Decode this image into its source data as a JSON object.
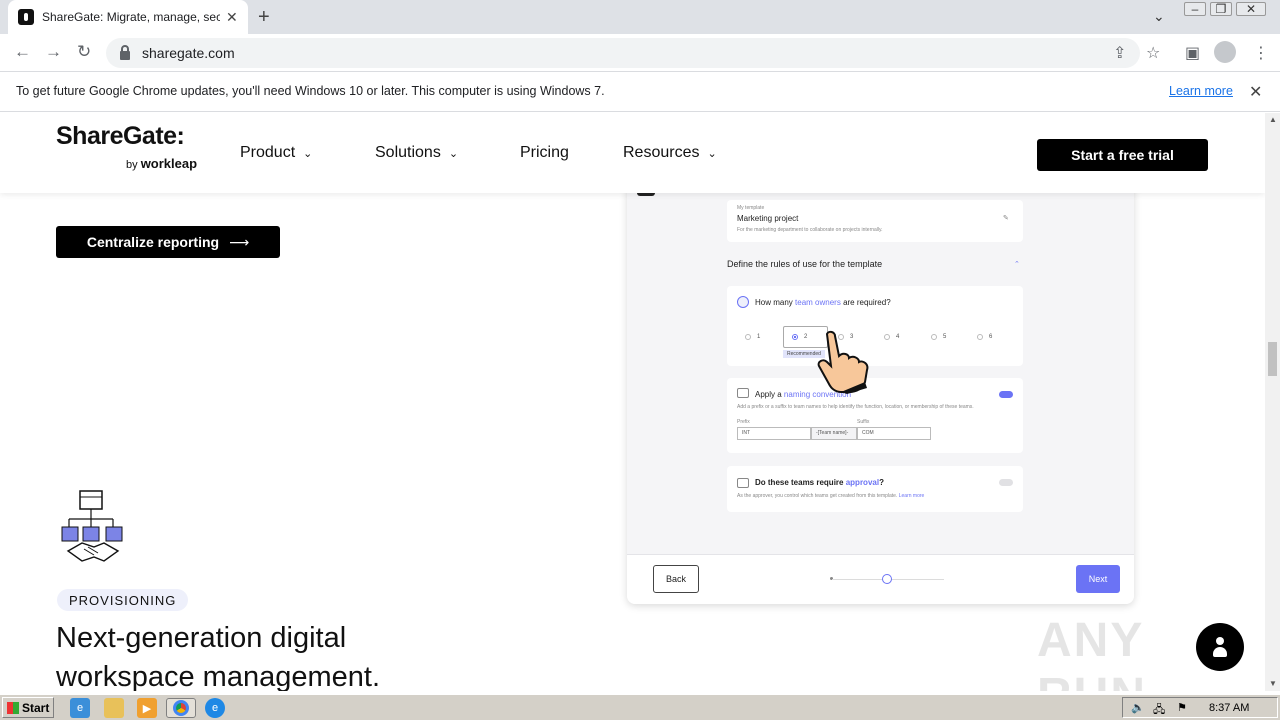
{
  "browser": {
    "tab_title": "ShareGate: Migrate, manage, secure",
    "url": "sharegate.com",
    "infobar_message": "To get future Google Chrome updates, you'll need Windows 10 or later. This computer is using Windows 7.",
    "infobar_link": "Learn more"
  },
  "site": {
    "logo": "ShareGate:",
    "logo_by": "by",
    "logo_parent": "workleap",
    "nav": [
      "Product",
      "Solutions",
      "Pricing",
      "Resources"
    ],
    "cta_trial": "Start a free trial"
  },
  "content": {
    "centralize_button": "Centralize reporting",
    "badge": "PROVISIONING",
    "headline": "Next-generation digital workspace management."
  },
  "mock": {
    "template_small": "My template",
    "template_name": "Marketing project",
    "template_desc": "For the marketing department to collaborate on projects internally.",
    "rules_title": "Define the rules of use for the template",
    "owners_q_pre": "How many",
    "owners_q_hl": "team owners",
    "owners_q_post": "are required?",
    "owner_options": [
      "1",
      "2",
      "3",
      "4",
      "5",
      "6"
    ],
    "owner_selected": "2",
    "recommended": "Recommended",
    "naming_pre": "Apply a",
    "naming_hl": "naming convention",
    "naming_desc": "Add a prefix or a suffix to team names to help identify the function, location, or membership of these teams.",
    "prefix_label": "Prefix",
    "suffix_label": "Suffix",
    "prefix_value": "INT",
    "team_name": "-[Team name]-",
    "suffix_value": "COM",
    "approval_pre": "Do these teams require",
    "approval_hl": "approval",
    "approval_post": "?",
    "approval_desc": "As the approver, you control which teams get created from this template.",
    "approval_link": "Learn more",
    "back": "Back",
    "next": "Next",
    "accent": "#6b73f5"
  },
  "overlay": {
    "watermark": "ANY RUN"
  },
  "taskbar": {
    "start": "Start",
    "time": "8:37 AM"
  }
}
